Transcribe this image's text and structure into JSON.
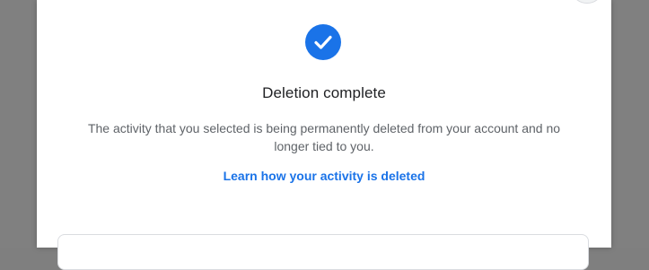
{
  "dialog": {
    "icon": "check-circle-icon",
    "accent_color": "#1a73e8",
    "title": "Deletion complete",
    "description": "The activity that you selected is being permanently deleted from your account and no longer tied to you.",
    "learn_link": "Learn how your activity is deleted"
  }
}
